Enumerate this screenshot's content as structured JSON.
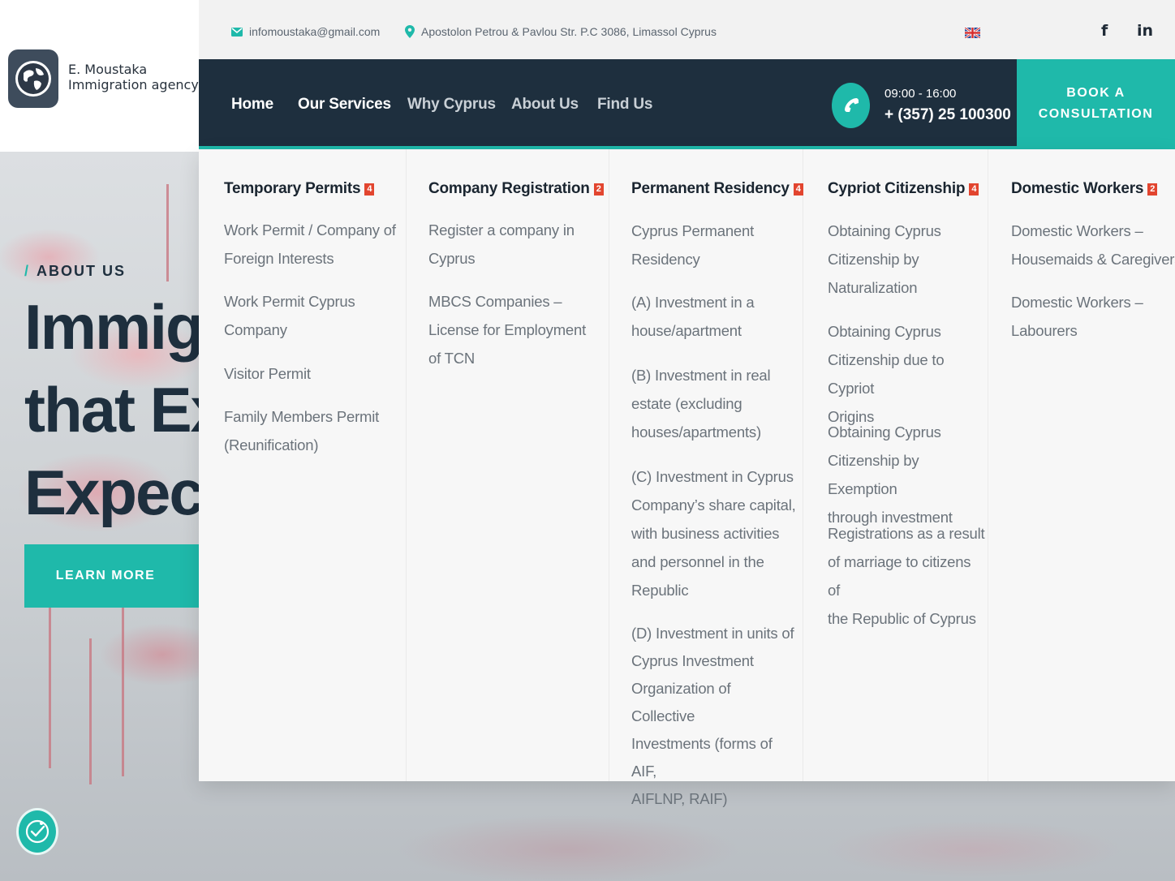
{
  "brand": {
    "name_line1": "E. Moustaka",
    "name_line2": "Immigration agency"
  },
  "topbar": {
    "email": "infomoustaka@gmail.com",
    "address": "Apostolon Petrou & Pavlou Str. P.C 3086, Limassol Cyprus",
    "language_flag": "uk-flag-icon",
    "social": {
      "facebook": "f",
      "linkedin": "in"
    }
  },
  "nav": {
    "items": [
      {
        "label": "Home"
      },
      {
        "label": "Our Services"
      },
      {
        "label": "Why Cyprus"
      },
      {
        "label": "About Us"
      },
      {
        "label": "Find Us"
      }
    ],
    "phone_hours": "09:00 - 16:00",
    "phone_number": "+ (357) 25 100300",
    "cta_line1": "BOOK A",
    "cta_line2": "CONSULTATION"
  },
  "hero": {
    "eyebrow_slash": "/",
    "eyebrow": "ABOUT US",
    "line1": "Immigr",
    "line2": "that Ex",
    "line3": "Expecta",
    "button": "LEARN MORE"
  },
  "mega_menu": {
    "columns": [
      {
        "title": "Temporary Permits",
        "count": "4",
        "items": [
          [
            "Work Permit / Company of",
            "Foreign Interests"
          ],
          [
            "Work Permit Cyprus",
            "Company"
          ],
          [
            "Visitor Permit"
          ],
          [
            "Family Members Permit",
            "(Reunification)"
          ]
        ]
      },
      {
        "title": "Company Registration",
        "count": "2",
        "items": [
          [
            "Register a company in",
            "Cyprus"
          ],
          [
            "MBCS Companies –",
            "License for Employment",
            "of TCN"
          ]
        ]
      },
      {
        "title": "Permanent Residency",
        "count": "4",
        "items": [
          [
            "Cyprus Permanent",
            "Residency"
          ],
          [
            "(A) Investment in a",
            "house/apartment"
          ],
          [
            "(B) Investment in real",
            "estate (excluding",
            "houses/apartments)"
          ],
          [
            "(C) Investment in Cyprus",
            "Company’s share capital,",
            "with business activities",
            "and personnel in the",
            "Republic"
          ],
          [
            "(D) Investment in units of",
            "Cyprus Investment",
            "Organization of Collective",
            "Investments (forms of AIF,",
            "AIFLNP, RAIF)"
          ]
        ]
      },
      {
        "title": "Cypriot Citizenship",
        "count": "4",
        "items": [
          [
            "Obtaining Cyprus",
            "Citizenship by",
            "Naturalization"
          ],
          [
            "Obtaining Cyprus",
            "Citizenship due to Cypriot",
            "Origins"
          ],
          [
            "Obtaining Cyprus",
            "Citizenship by Exemption",
            "through investment"
          ],
          [
            "Registrations as a result",
            "of marriage to citizens of",
            "the Republic of Cyprus"
          ]
        ]
      },
      {
        "title": "Domestic Workers",
        "count": "2",
        "items": [
          [
            "Domestic Workers –",
            "Housemaids & Caregivers"
          ],
          [
            "Domestic Workers –",
            "Labourers"
          ]
        ]
      }
    ]
  },
  "colors": {
    "navy": "#1e2f3e",
    "teal": "#1fb9aa",
    "badge_red": "#e2452f",
    "menu_text": "#6b737b"
  }
}
